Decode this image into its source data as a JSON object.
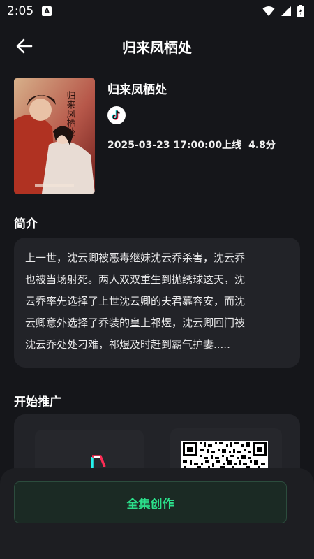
{
  "status_bar": {
    "time": "2:05",
    "app_badge": "A",
    "icons": [
      "wifi-icon",
      "signal-icon",
      "battery-icon"
    ]
  },
  "header": {
    "title": "归来凤栖处",
    "back_icon": "back-arrow-icon"
  },
  "drama": {
    "title": "归来凤栖处",
    "platform_icon": "tiktok-icon",
    "release": "2025-03-23 17:00:00上线",
    "rating": "4.8分",
    "poster_calligraphy": "归来凤栖处"
  },
  "intro": {
    "heading": "简介",
    "lines": [
      "上一世，沈云卿被恶毒继妹沈云乔杀害，沈云乔",
      "也被当场射死。两人双双重生到抛绣球这天，沈",
      "云乔率先选择了上世沈云卿的夫君慕容安，而沈",
      "云卿意外选择了乔装的皇上祁煜，沈云卿回门被",
      "沈云乔处处刁难，祁煜及时赶到霸气护妻....."
    ]
  },
  "promotion": {
    "heading": "开始推广"
  },
  "action": {
    "label": "全集创作"
  },
  "colors": {
    "background": "#15161a",
    "card": "#222328",
    "accent": "#2be08b"
  }
}
